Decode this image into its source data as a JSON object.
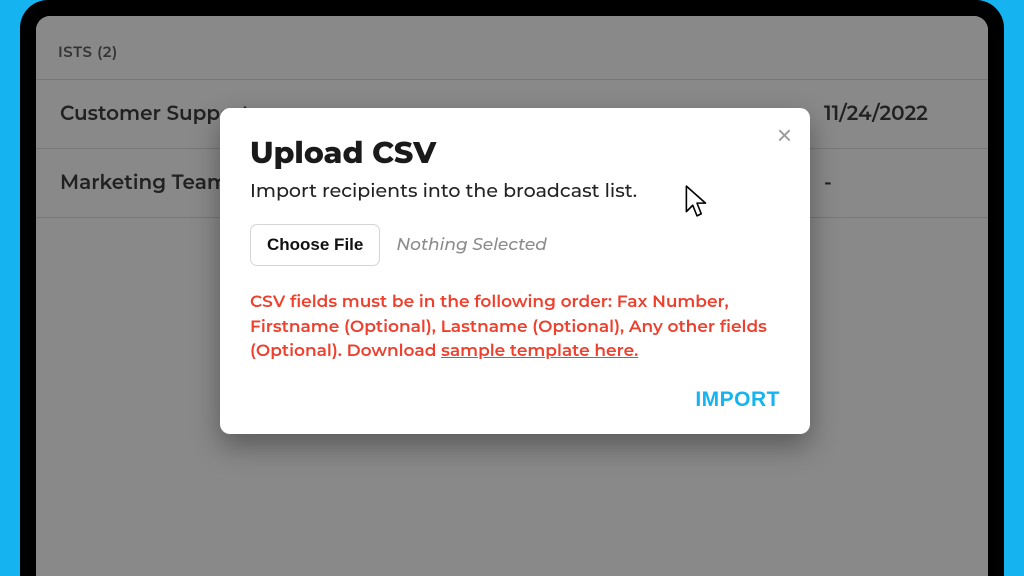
{
  "page": {
    "section_header": "ISTS (2)",
    "rows": [
      {
        "name": "Customer Support",
        "date": "11/24/2022"
      },
      {
        "name": "Marketing Team",
        "date": "-"
      }
    ]
  },
  "modal": {
    "title": "Upload CSV",
    "subtitle": "Import recipients into the broadcast list.",
    "choose_file_label": "Choose File",
    "file_status": "Nothing Selected",
    "instructions_prefix": "CSV fields must be in the following order: Fax Number, Firstname (Optional), Lastname (Optional), Any other fields (Optional). Download ",
    "sample_link_text": "sample template here.",
    "import_label": "IMPORT",
    "close_glyph": "×"
  }
}
